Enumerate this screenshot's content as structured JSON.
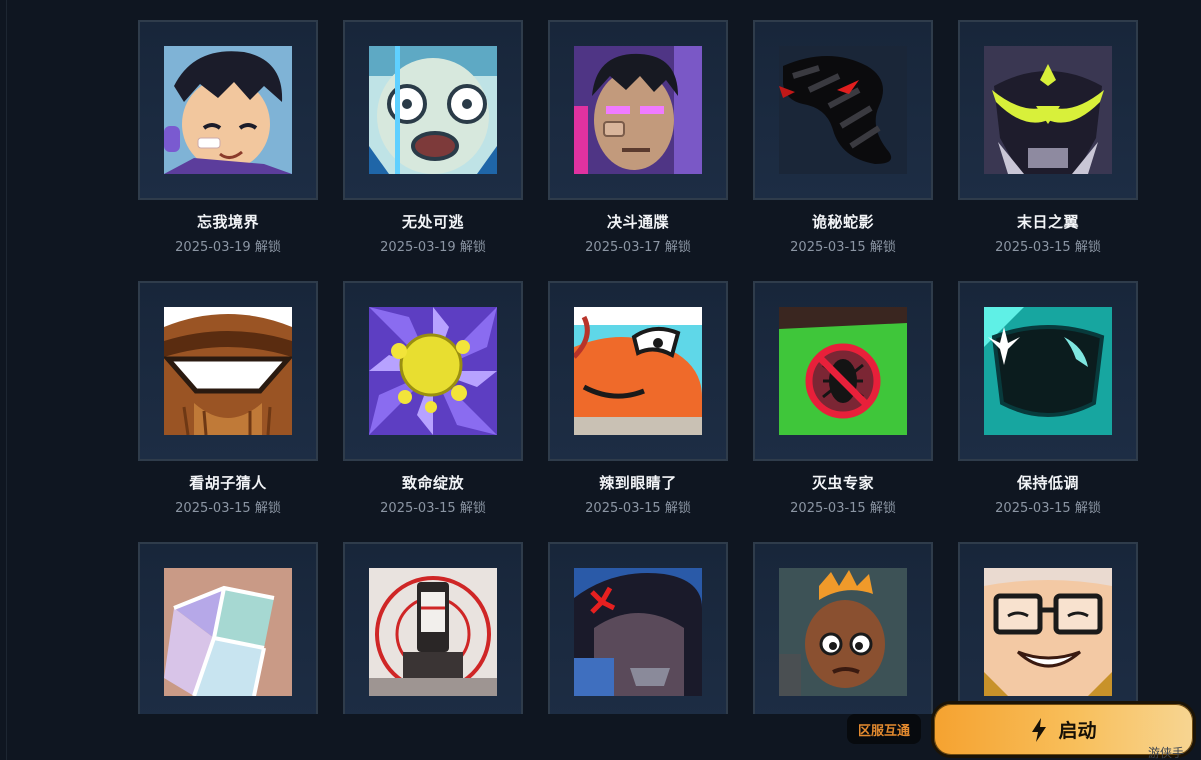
{
  "achievements": [
    {
      "name": "忘我境界",
      "date": "2025-03-19 解锁",
      "icon": "chibi-headset-avatar-icon"
    },
    {
      "name": "无处可逃",
      "date": "2025-03-19 解锁",
      "icon": "startled-face-icon"
    },
    {
      "name": "决斗通牒",
      "date": "2025-03-17 解锁",
      "icon": "glowing-eyes-agent-icon"
    },
    {
      "name": "诡秘蛇影",
      "date": "2025-03-15 解锁",
      "icon": "shadow-serpent-icon"
    },
    {
      "name": "末日之翼",
      "date": "2025-03-15 解锁",
      "icon": "armored-visor-icon"
    },
    {
      "name": "看胡子猜人",
      "date": "2025-03-15 解锁",
      "icon": "beard-goggles-icon"
    },
    {
      "name": "致命绽放",
      "date": "2025-03-15 解锁",
      "icon": "yellow-bloom-icon"
    },
    {
      "name": "辣到眼睛了",
      "date": "2025-03-15 解锁",
      "icon": "orange-creature-icon"
    },
    {
      "name": "灭虫专家",
      "date": "2025-03-15 解锁",
      "icon": "no-bugs-icon"
    },
    {
      "name": "保持低调",
      "date": "2025-03-15 解锁",
      "icon": "dark-sunglasses-icon"
    },
    {
      "name": "",
      "date": "",
      "icon": "stained-glass-icon"
    },
    {
      "name": "",
      "date": "",
      "icon": "crosshair-tower-icon"
    },
    {
      "name": "",
      "date": "",
      "icon": "angry-agent-icon"
    },
    {
      "name": "",
      "date": "",
      "icon": "mohawk-kid-icon"
    },
    {
      "name": "",
      "date": "",
      "icon": "glasses-grin-icon"
    }
  ],
  "footer": {
    "region_badge": "区服互通",
    "launch_label": "启动",
    "launch_icon": "lightning-bolt-icon",
    "watermark": "游侠手"
  },
  "colors": {
    "background": "#0f1621",
    "accent": "#f5a230",
    "badge_text": "#e38a2f"
  }
}
